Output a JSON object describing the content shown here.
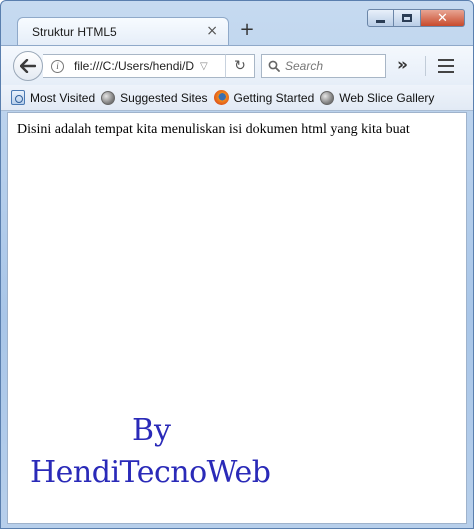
{
  "tab": {
    "title": "Struktur HTML5",
    "close_glyph": "×"
  },
  "new_tab_glyph": "+",
  "navbar": {
    "url": "file:///C:/Users/hendi/D",
    "search_placeholder": "Search",
    "overflow_glyph": "»",
    "reload_glyph": "↻",
    "dropdown_glyph": "▽"
  },
  "bookmarks": [
    {
      "label": "Most Visited",
      "icon": "most-visited-icon"
    },
    {
      "label": "Suggested Sites",
      "icon": "globe-icon"
    },
    {
      "label": "Getting Started",
      "icon": "firefox-icon"
    },
    {
      "label": "Web Slice Gallery",
      "icon": "globe-icon"
    }
  ],
  "content": {
    "text": "Disini adalah tempat kita menuliskan isi dokumen html yang kita buat"
  },
  "watermark": {
    "by": "By",
    "name": "HendiTecnoWeb",
    "color": "#2a2ab8"
  }
}
